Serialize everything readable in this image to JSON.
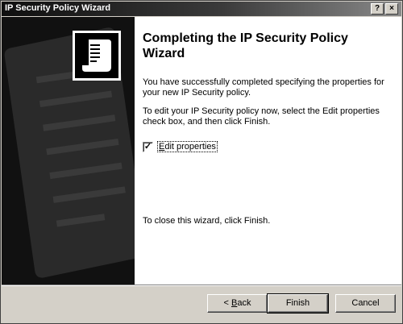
{
  "window": {
    "title": "IP Security Policy Wizard",
    "help_label": "?",
    "close_label": "×"
  },
  "content": {
    "heading": "Completing the IP Security Policy Wizard",
    "paragraph1": "You have successfully completed specifying the properties for your new IP Security policy.",
    "paragraph2": "To edit your IP Security policy now, select the Edit properties check box, and then click Finish.",
    "checkbox": {
      "label_hotkey": "E",
      "label_rest": "dit properties",
      "checked_mark": "✓"
    },
    "paragraph3": "To close this wizard, click Finish."
  },
  "buttons": {
    "back_prefix": "< ",
    "back_hotkey": "B",
    "back_rest": "ack",
    "finish": "Finish",
    "cancel": "Cancel"
  },
  "icons": {
    "wizard_graphic": "document-scroll-icon"
  }
}
